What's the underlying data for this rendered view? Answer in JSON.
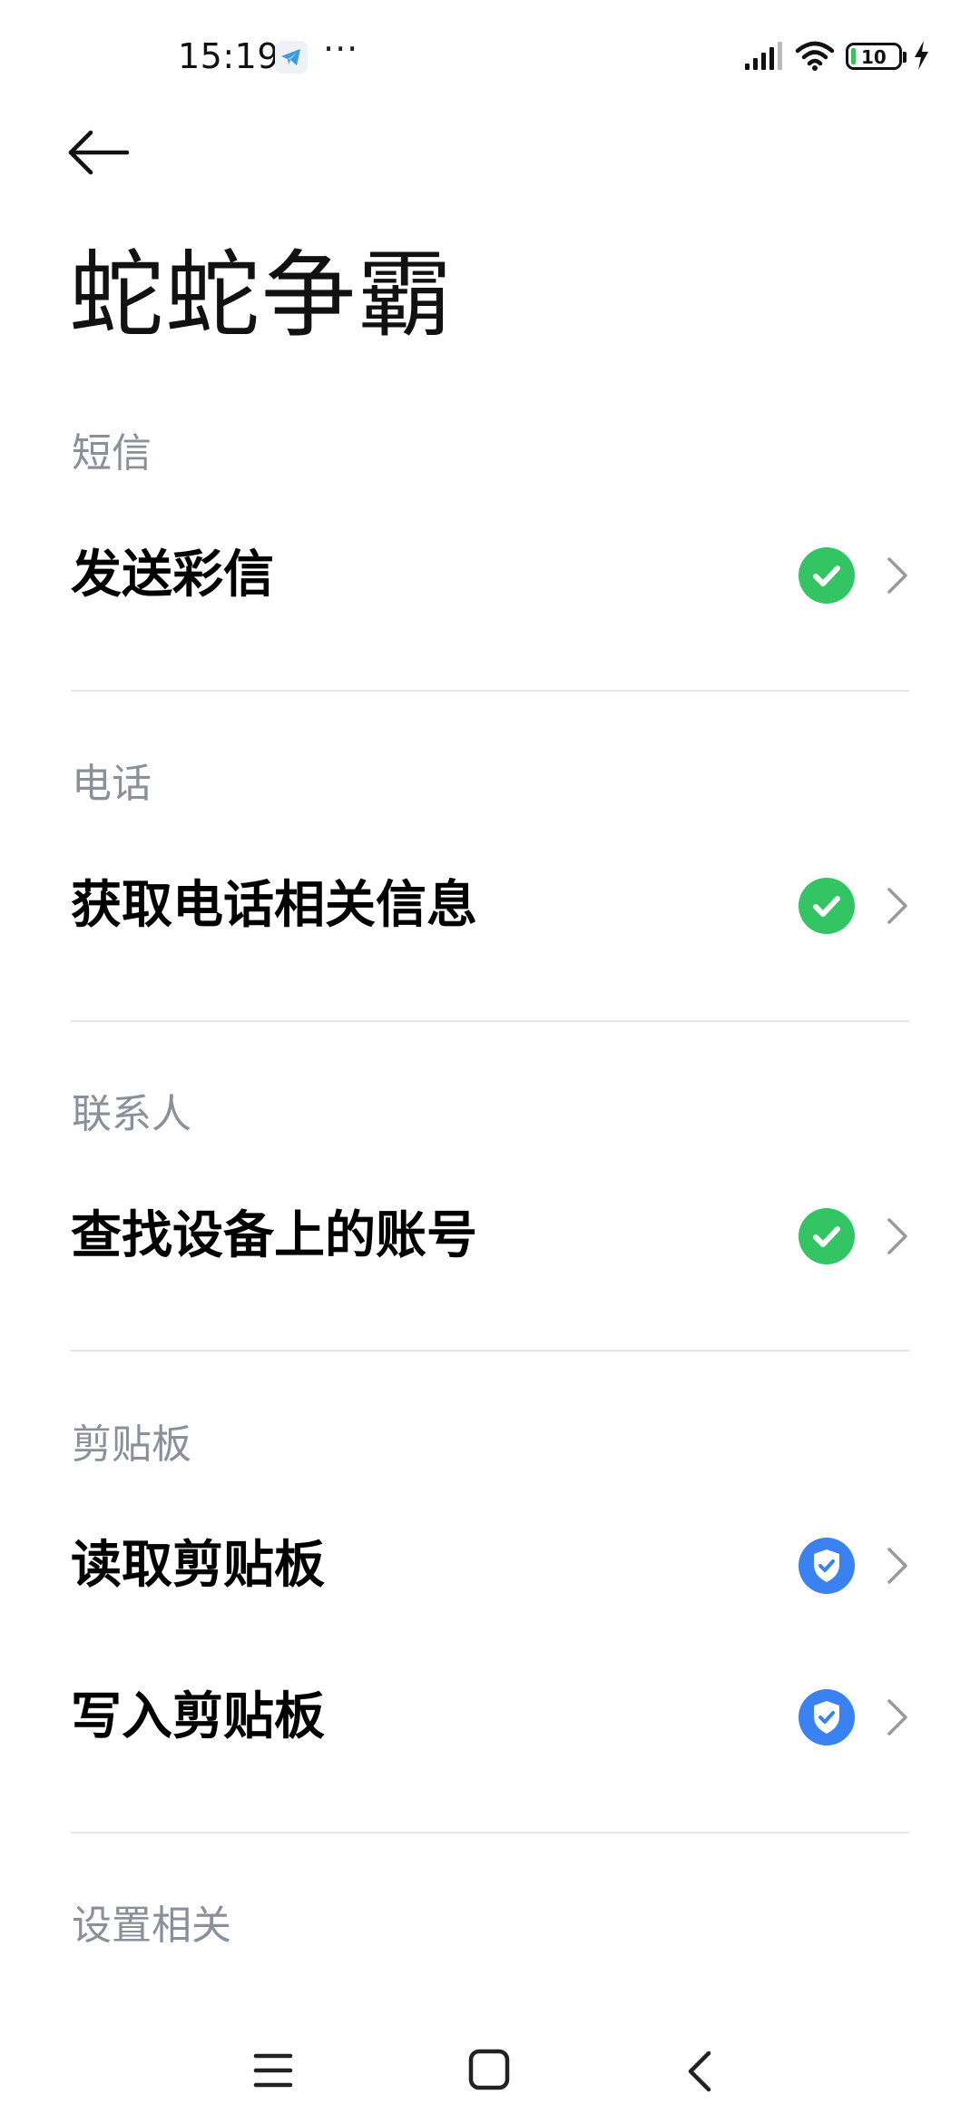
{
  "status_bar": {
    "time": "15:19",
    "app_icon": "telegram-icon",
    "more": "···",
    "battery_level": "10",
    "battery_percent": 10,
    "icons": [
      "signal-icon",
      "wifi-icon",
      "battery-icon",
      "charging-icon"
    ]
  },
  "header": {
    "back_icon": "back-arrow-icon",
    "title": "蛇蛇争霸"
  },
  "sections": [
    {
      "header": "短信",
      "items": [
        {
          "label": "发送彩信",
          "status": "allowed",
          "status_color": "#33c463",
          "status_icon": "check-circle-icon"
        }
      ]
    },
    {
      "header": "电话",
      "items": [
        {
          "label": "获取电话相关信息",
          "status": "allowed",
          "status_color": "#33c463",
          "status_icon": "check-circle-icon"
        }
      ]
    },
    {
      "header": "联系人",
      "items": [
        {
          "label": "查找设备上的账号",
          "status": "allowed",
          "status_color": "#33c463",
          "status_icon": "check-circle-icon"
        }
      ]
    },
    {
      "header": "剪贴板",
      "items": [
        {
          "label": "读取剪贴板",
          "status": "allowed-while-using",
          "status_color": "#3a82f2",
          "status_icon": "shield-check-icon"
        },
        {
          "label": "写入剪贴板",
          "status": "allowed-while-using",
          "status_color": "#3a82f2",
          "status_icon": "shield-check-icon"
        }
      ]
    },
    {
      "header": "设置相关",
      "items": []
    }
  ],
  "nav_bar": {
    "menu_icon": "menu-icon",
    "home_icon": "home-icon",
    "back_icon": "back-icon"
  },
  "colors": {
    "allowed": "#33c463",
    "while_using": "#3a82f2",
    "section_header": "#8a8f99"
  }
}
